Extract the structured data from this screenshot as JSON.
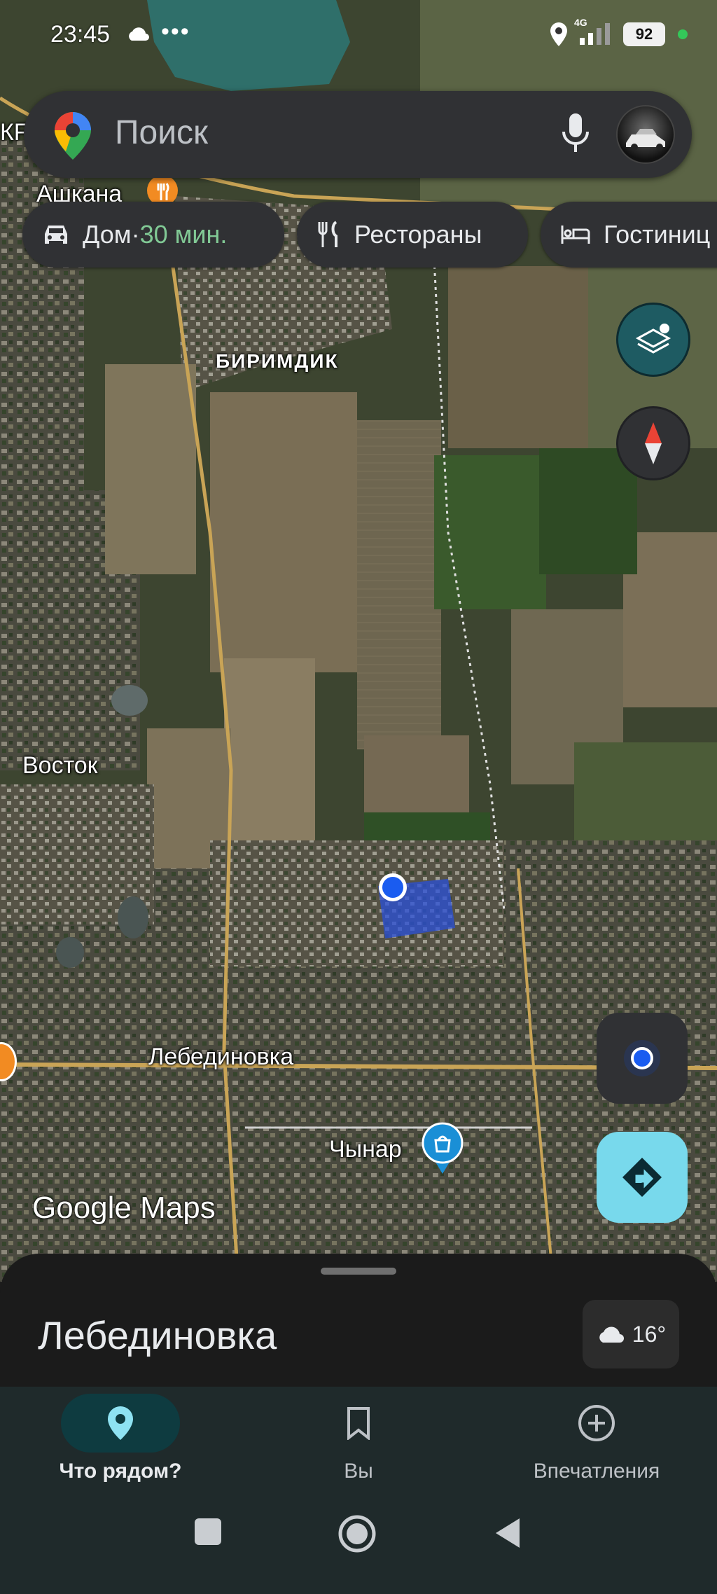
{
  "status_bar": {
    "time": "23:45",
    "more": "•••",
    "network": "4G",
    "battery": "92"
  },
  "search": {
    "placeholder": "Поиск"
  },
  "chips": [
    {
      "label": "Дом",
      "separator": " · ",
      "eta": "30 мин.",
      "icon": "car-icon"
    },
    {
      "label": "Рестораны",
      "icon": "fork-knife-icon"
    },
    {
      "label": "Гостиниц",
      "icon": "bed-icon"
    }
  ],
  "map": {
    "labels": {
      "kf": "КF",
      "ashkana": "Ашкана",
      "birimdik": "БИРИМДИК",
      "vostok": "Восток",
      "lebedinovka": "Лебединовка",
      "chynar": "Чынар"
    },
    "logo": "Google Maps"
  },
  "sheet": {
    "title": "Лебединовка",
    "weather": "16°",
    "weather_icon": "cloud-icon"
  },
  "nav": [
    {
      "label": "Что рядом?",
      "icon": "pin-icon",
      "active": true
    },
    {
      "label": "Вы",
      "icon": "bookmark-icon",
      "active": false
    },
    {
      "label": "Впечатления",
      "icon": "plus-circle-icon",
      "active": false
    }
  ],
  "colors": {
    "accent_teal": "#78d9ec",
    "eta_green": "#81c995",
    "location_blue": "#1a73e8",
    "surface": "#303134"
  }
}
